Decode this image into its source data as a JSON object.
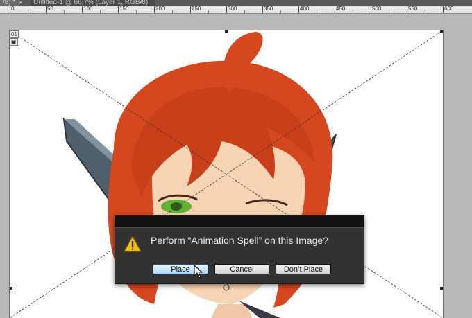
{
  "tabs": [
    {
      "label": "/8) *",
      "close": "×"
    },
    {
      "label": "Untitled-1 @ 66,7% (Layer 1, RGB/8)",
      "close": "×"
    }
  ],
  "ruler": {
    "labels": [
      "0",
      "50",
      "100",
      "150",
      "200",
      "250",
      "300",
      "350",
      "400",
      "450",
      "500",
      "550",
      "600"
    ]
  },
  "artboard": {
    "corner_label": "01",
    "corner_icon": "artboard-icon"
  },
  "dialog": {
    "icon": "warning-icon",
    "message": "Perform “Animation Spell” on this Image?",
    "buttons": {
      "place": "Place",
      "cancel": "Cancel",
      "dont_place": "Don’t Place"
    }
  },
  "colors": {
    "hair": "#d4471f",
    "skin": "#f6d4b4",
    "eye": "#5fb233",
    "dialog_bg": "#323232",
    "accent_button": "#a9d6f5"
  }
}
